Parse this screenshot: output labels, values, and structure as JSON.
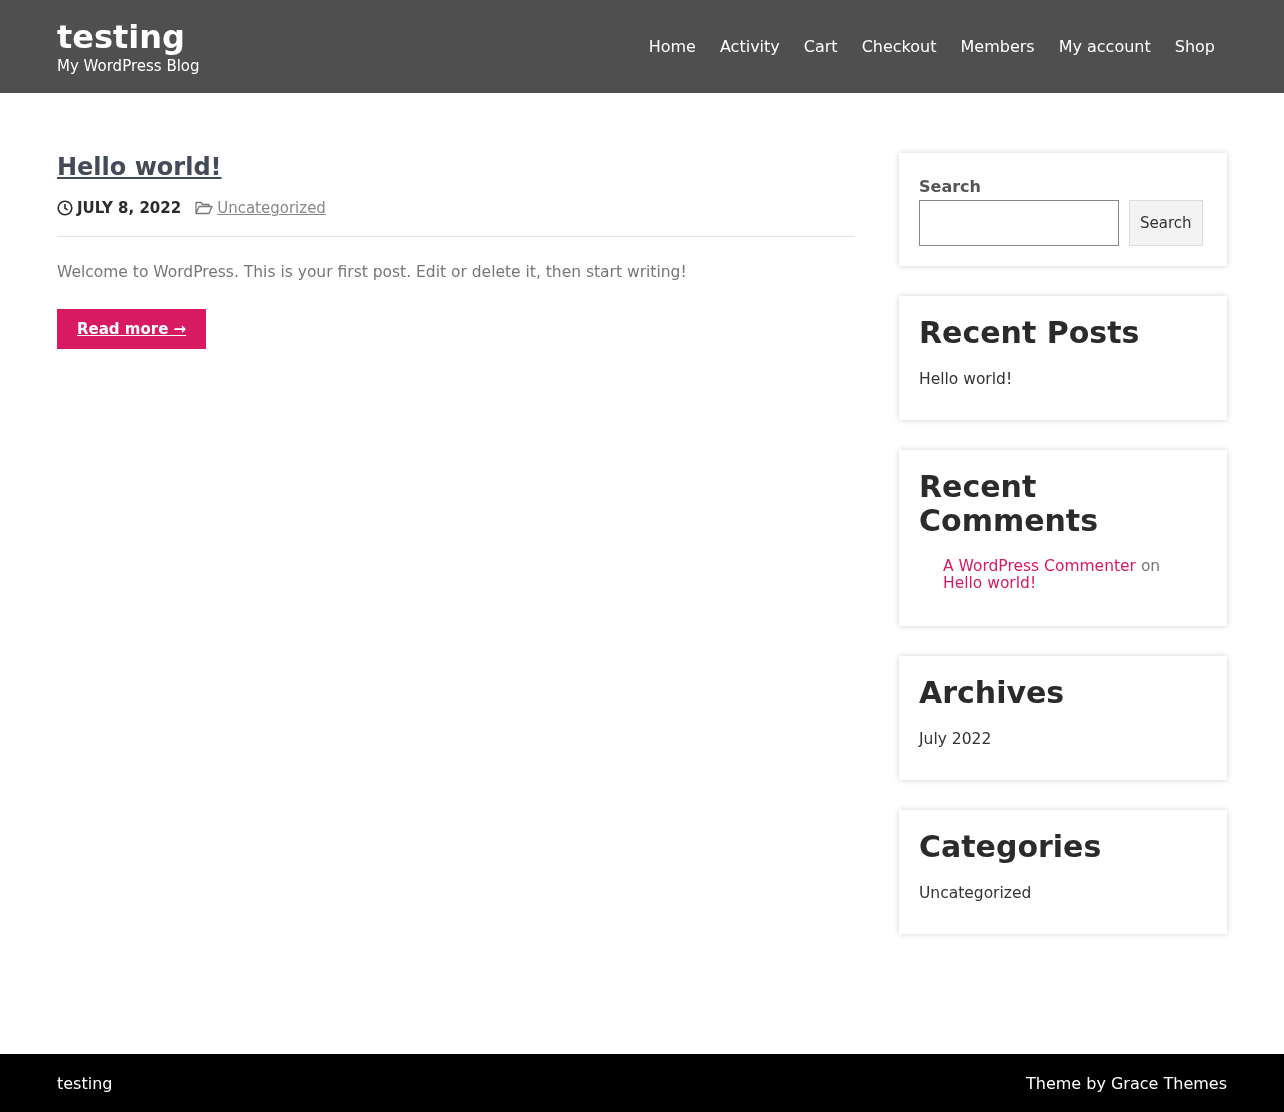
{
  "site": {
    "title": "testing",
    "tagline": "My WordPress Blog"
  },
  "nav": [
    "Home",
    "Activity",
    "Cart",
    "Checkout",
    "Members",
    "My account",
    "Shop"
  ],
  "post": {
    "title": "Hello world!",
    "date": "JULY 8, 2022",
    "category": "Uncategorized",
    "excerpt": "Welcome to WordPress. This is your first post. Edit or delete it, then start writing!",
    "read_more": "Read more →"
  },
  "sidebar": {
    "search": {
      "label": "Search",
      "button": "Search"
    },
    "widgets": [
      {
        "kind": "links",
        "title": "Recent Posts",
        "items": [
          "Hello world!"
        ]
      },
      {
        "kind": "comments",
        "title": "Recent Comments",
        "comments": [
          {
            "author": "A WordPress Commenter",
            "joiner": "on",
            "post": "Hello world!"
          }
        ]
      },
      {
        "kind": "links",
        "title": "Archives",
        "items": [
          "July 2022"
        ]
      },
      {
        "kind": "links",
        "title": "Categories",
        "items": [
          "Uncategorized"
        ]
      }
    ]
  },
  "footer": {
    "left": "testing",
    "right": "Theme by Grace Themes"
  }
}
